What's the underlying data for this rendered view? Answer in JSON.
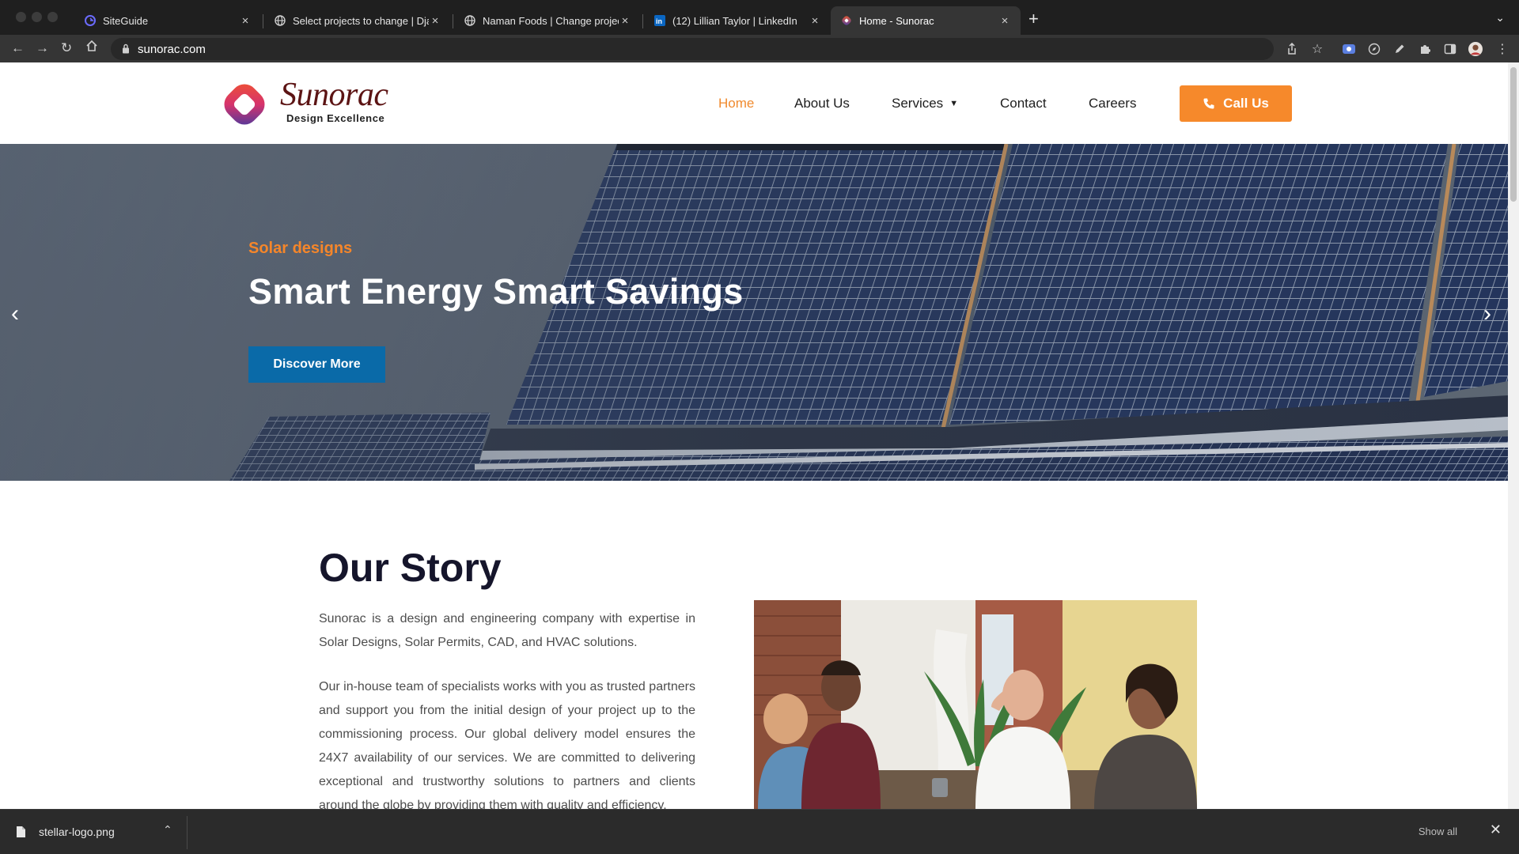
{
  "browser": {
    "tabs": [
      {
        "title": "SiteGuide",
        "favicon": "siteguide-icon",
        "active": false
      },
      {
        "title": "Select projects to change | Dja",
        "favicon": "globe-icon",
        "active": false
      },
      {
        "title": "Naman Foods | Change project",
        "favicon": "globe-icon",
        "active": false
      },
      {
        "title": "(12) Lillian Taylor | LinkedIn",
        "favicon": "linkedin-icon",
        "active": false
      },
      {
        "title": "Home - Sunorac",
        "favicon": "sunorac-icon",
        "active": true
      }
    ],
    "new_tab_label": "+",
    "url": "sunorac.com"
  },
  "site": {
    "logo_name": "Sunorac",
    "logo_tagline": "Design Excellence",
    "nav": [
      {
        "label": "Home",
        "active": true
      },
      {
        "label": "About Us",
        "active": false
      },
      {
        "label": "Services",
        "active": false,
        "has_dropdown": true
      },
      {
        "label": "Contact",
        "active": false
      },
      {
        "label": "Careers",
        "active": false
      }
    ],
    "call_button": "Call Us",
    "accent_color": "#f6892b",
    "primary_color": "#0a6aa8"
  },
  "hero": {
    "kicker": "Solar designs",
    "title": "Smart Energy Smart Savings",
    "button": "Discover More"
  },
  "story": {
    "title": "Our Story",
    "paragraph1": "Sunorac is a design and engineering company with expertise in Solar Designs, Solar Permits, CAD, and HVAC solutions.",
    "paragraph2": "Our in-house team of specialists works with you as trusted partners and support you from the initial design of your project up to the commissioning process. Our global delivery model ensures the 24X7 availability of our services. We are committed to delivering exceptional and trustworthy solutions to partners and clients around the globe by providing them with quality and efficiency."
  },
  "downloads": {
    "file_name": "stellar-logo.png",
    "show_all": "Show all"
  }
}
